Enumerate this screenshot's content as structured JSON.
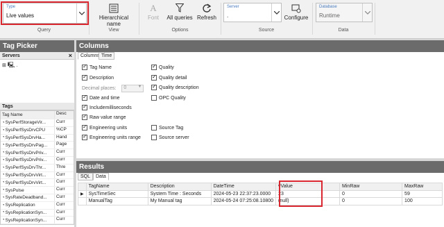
{
  "ribbon": {
    "query": {
      "type_caption": "Type",
      "type_value": "Live values",
      "group_label": "Query"
    },
    "view": {
      "hierarchical_label": "Hierarchical name",
      "group_label": "View"
    },
    "options": {
      "font_label": "Font",
      "all_queries_label": "All queries",
      "refresh_label": "Refresh",
      "group_label": "Options"
    },
    "source": {
      "server_caption": "Server",
      "server_value": ".",
      "configure_label": "Configure",
      "group_label": "Source"
    },
    "data": {
      "database_caption": "Database",
      "database_value": "Runtime",
      "group_label": "Data"
    }
  },
  "tag_picker": {
    "title": "Tag Picker",
    "servers_label": "Servers",
    "server_node": ".",
    "tags_label": "Tags",
    "columns": [
      "Tag Name",
      "Desc"
    ],
    "rows": [
      {
        "name": "SysPerfStorageVir...",
        "desc": "Curr"
      },
      {
        "name": "SysPerfSysDrvCPU",
        "desc": "%CP"
      },
      {
        "name": "SysPerfSysDrvHa...",
        "desc": "Hand"
      },
      {
        "name": "SysPerfSysDrvPag...",
        "desc": "Page"
      },
      {
        "name": "SysPerfSysDrvPriv...",
        "desc": "Curr"
      },
      {
        "name": "SysPerfSysDrvPriv...",
        "desc": "Curr"
      },
      {
        "name": "SysPerfSysDrvThr...",
        "desc": "Thre"
      },
      {
        "name": "SysPerfSysDrvVirt...",
        "desc": "Curr"
      },
      {
        "name": "SysPerfSysDrvVirt...",
        "desc": "Curr"
      },
      {
        "name": "SysPulse",
        "desc": "Curr"
      },
      {
        "name": "SysRateDeadband...",
        "desc": "Curr"
      },
      {
        "name": "SysReplication",
        "desc": "Curr"
      },
      {
        "name": "SysReplicationSyn...",
        "desc": "Curr"
      },
      {
        "name": "SysReplicationSyn...",
        "desc": "Curr"
      }
    ]
  },
  "columns_panel": {
    "title": "Columns",
    "tabs": [
      "Columns",
      "Time"
    ],
    "left_options": [
      {
        "label": "Tag Name",
        "checked": true
      },
      {
        "label": "Description",
        "checked": true
      },
      {
        "label": "Date and time",
        "checked": true
      },
      {
        "label": "Includemilliseconds",
        "checked": true
      },
      {
        "label": "Raw value range",
        "checked": true
      },
      {
        "label": "Engineering units",
        "checked": true
      },
      {
        "label": "Engineering units range",
        "checked": true
      }
    ],
    "decimal_places_label": "Decimal places:",
    "decimal_places_value": "0",
    "right_options": [
      {
        "label": "Quality",
        "checked": true
      },
      {
        "label": "Quality detail",
        "checked": true
      },
      {
        "label": "Quality description",
        "checked": true
      },
      {
        "label": "OPC Quality",
        "checked": false
      },
      {
        "label": "Source Tag",
        "checked": false
      },
      {
        "label": "Source server",
        "checked": false
      }
    ]
  },
  "results": {
    "title": "Results",
    "tabs": [
      "SQL",
      "Data"
    ],
    "columns": [
      "TagName",
      "Description",
      "DateTime",
      "vValue",
      "MinRaw",
      "MaxRaw"
    ],
    "rows": [
      [
        "SysTimeSec",
        "System Time : Seconds",
        "2024-05-23 22:37:23.0000",
        "23",
        "0",
        "59"
      ],
      [
        "ManualTag",
        "My Manual tag",
        "2024-05-24 07:25:08.10800",
        "(null)",
        "0",
        "100"
      ]
    ]
  },
  "colors": {
    "highlight": "#d9262f",
    "panel_header": "#6b6b6b",
    "caption_blue": "#4a7bbd"
  }
}
